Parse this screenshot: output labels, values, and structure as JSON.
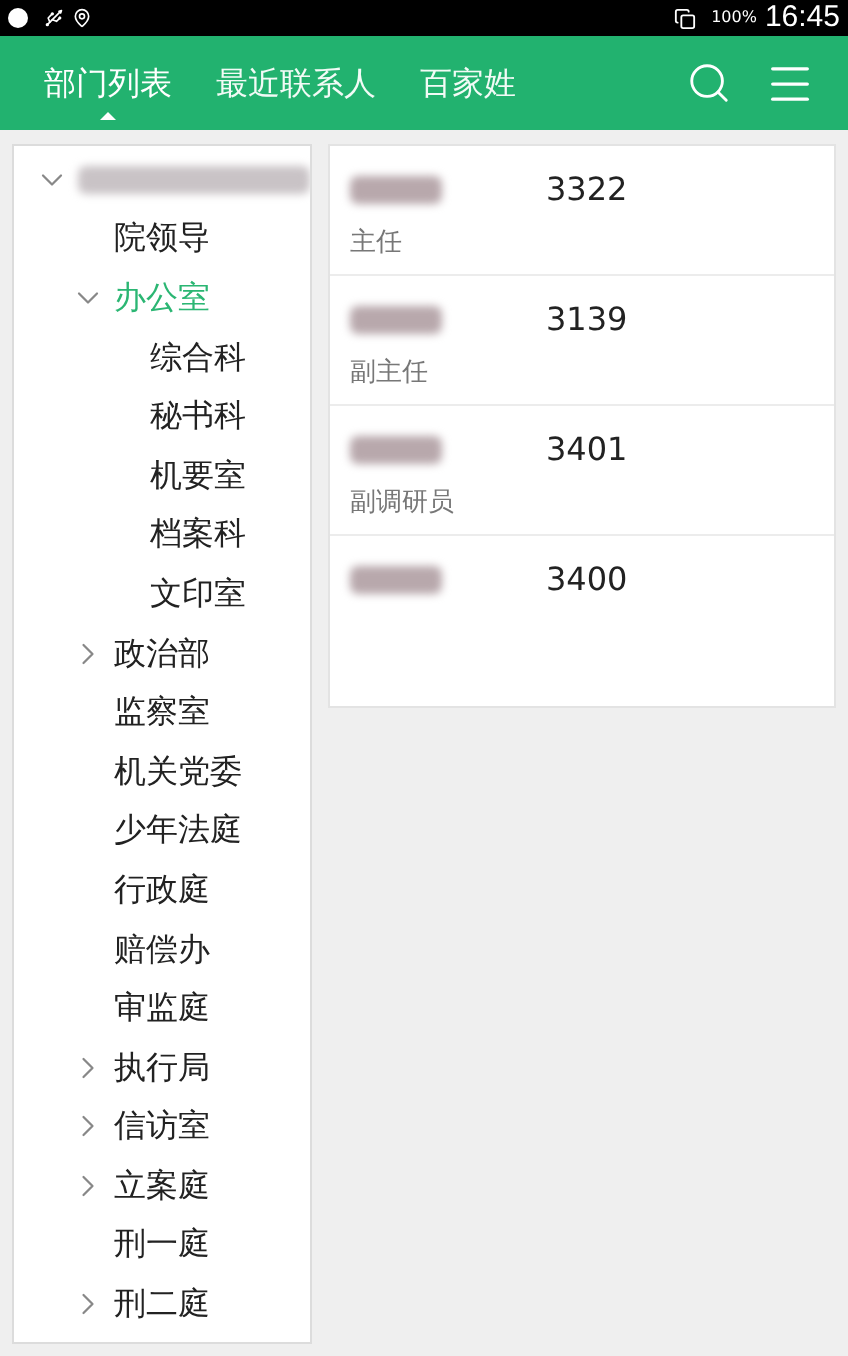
{
  "status_bar": {
    "battery": "100%",
    "time": "16:45"
  },
  "tabs": [
    {
      "label": "部门列表",
      "selected": true
    },
    {
      "label": "最近联系人",
      "selected": false
    },
    {
      "label": "百家姓",
      "selected": false
    }
  ],
  "tree": [
    {
      "kind": "redacted",
      "expanded": true,
      "selected": false,
      "children": [
        {
          "kind": "leaf",
          "label": "院领导",
          "selected": false
        },
        {
          "kind": "group",
          "label": "办公室",
          "expanded": true,
          "selected": true,
          "children": [
            {
              "kind": "leaf",
              "label": "综合科",
              "selected": false
            },
            {
              "kind": "leaf",
              "label": "秘书科",
              "selected": false
            },
            {
              "kind": "leaf",
              "label": "机要室",
              "selected": false
            },
            {
              "kind": "leaf",
              "label": "档案科",
              "selected": false
            },
            {
              "kind": "leaf",
              "label": "文印室",
              "selected": false
            }
          ]
        },
        {
          "kind": "group",
          "label": "政治部",
          "expanded": false,
          "selected": false
        },
        {
          "kind": "leaf",
          "label": "监察室",
          "selected": false
        },
        {
          "kind": "leaf",
          "label": "机关党委",
          "selected": false
        },
        {
          "kind": "leaf",
          "label": "少年法庭",
          "selected": false
        },
        {
          "kind": "leaf",
          "label": "行政庭",
          "selected": false
        },
        {
          "kind": "leaf",
          "label": "赔偿办",
          "selected": false
        },
        {
          "kind": "leaf",
          "label": "审监庭",
          "selected": false
        },
        {
          "kind": "group",
          "label": "执行局",
          "expanded": false,
          "selected": false
        },
        {
          "kind": "group",
          "label": "信访室",
          "expanded": false,
          "selected": false
        },
        {
          "kind": "group",
          "label": "立案庭",
          "expanded": false,
          "selected": false
        },
        {
          "kind": "leaf",
          "label": "刑一庭",
          "selected": false
        },
        {
          "kind": "group",
          "label": "刑二庭",
          "expanded": false,
          "selected": false
        }
      ]
    }
  ],
  "contacts": [
    {
      "name_redacted": true,
      "extension": "3322",
      "title": "主任"
    },
    {
      "name_redacted": true,
      "extension": "3139",
      "title": "副主任"
    },
    {
      "name_redacted": true,
      "extension": "3401",
      "title": "副调研员"
    },
    {
      "name_redacted": true,
      "extension": "3400"
    }
  ]
}
